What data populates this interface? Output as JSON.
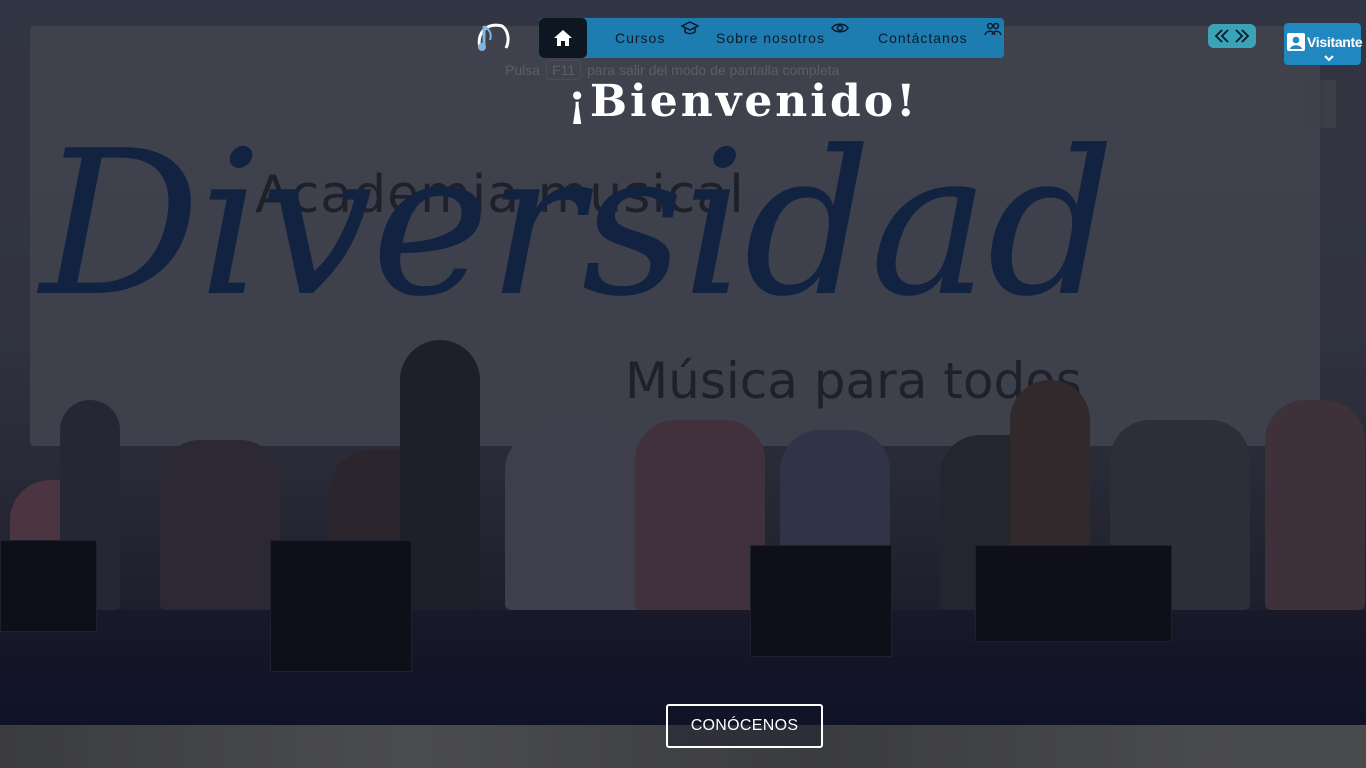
{
  "nav": {
    "home_icon": "home-icon",
    "items": [
      {
        "label": "Cursos",
        "icon": "graduation-cap-icon"
      },
      {
        "label": "Sobre nosotros",
        "icon": "eye-icon"
      },
      {
        "label": "Contáctanos",
        "icon": "users-icon"
      }
    ],
    "color": "#1d7db1"
  },
  "fullscreen_hint": {
    "before": "Pulsa",
    "key": "F11",
    "after": "para salir del modo de pantalla completa"
  },
  "hero": {
    "title": "¡Bienvenido!",
    "banner_line1": "Academia musical",
    "banner_big": "Diversidad",
    "banner_line3": "Música para todos",
    "cta_label": "CONÓCENOS"
  },
  "user_menu": {
    "label": "Visitante",
    "icon": "user-icon",
    "chevron": "chevron-down-icon"
  },
  "arrows_icon": "double-chevron-icon"
}
